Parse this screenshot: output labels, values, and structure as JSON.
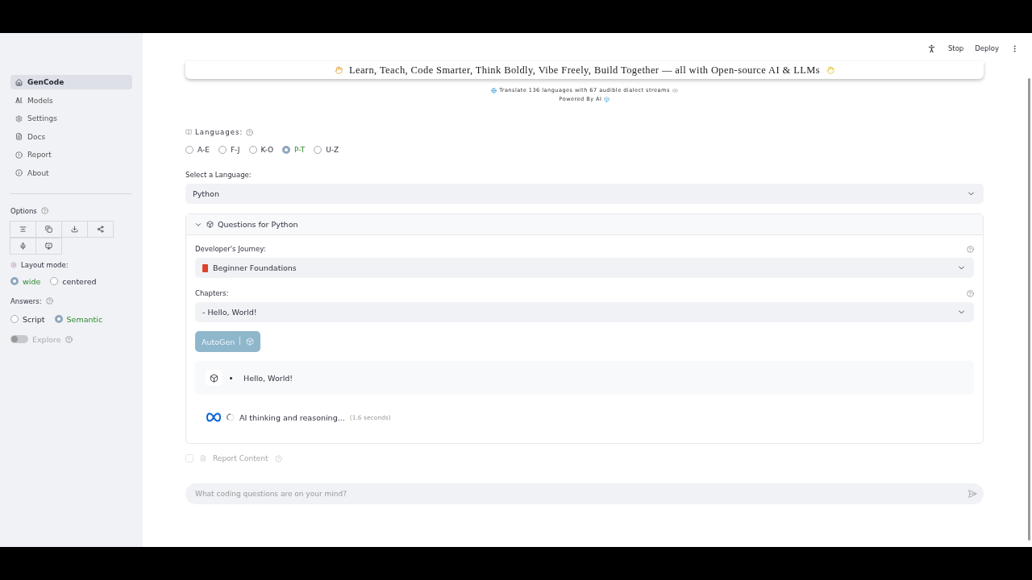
{
  "toolbar": {
    "status": "Stop",
    "deploy": "Deploy"
  },
  "sidebar": {
    "nav": [
      {
        "label": "GenCode",
        "selected": true
      },
      {
        "label": "Models",
        "selected": false
      },
      {
        "label": "Settings",
        "selected": false
      },
      {
        "label": "Docs",
        "selected": false
      },
      {
        "label": "Report",
        "selected": false
      },
      {
        "label": "About",
        "selected": false
      }
    ],
    "options_label": "Options",
    "layout_label": "Layout mode:",
    "layout_modes": [
      {
        "label": "wide",
        "selected": true
      },
      {
        "label": "centered",
        "selected": false
      }
    ],
    "answers_label": "Answers:",
    "answers": [
      {
        "label": "Script",
        "selected": false
      },
      {
        "label": "Semantic",
        "selected": true
      }
    ],
    "explore": {
      "label": "Explore",
      "on": false
    }
  },
  "banner": {
    "text": "Learn, Teach, Code Smarter, Think Boldly, Vibe Freely, Build Together — all with Open-source AI & LLMs",
    "line1": "Translate 136 languages with 67 audible dialect streams",
    "line2": "Powered By AI"
  },
  "languages": {
    "label": "Languages:",
    "ranges": [
      {
        "label": "A-E",
        "selected": false
      },
      {
        "label": "F-J",
        "selected": false
      },
      {
        "label": "K-O",
        "selected": false
      },
      {
        "label": "P-T",
        "selected": true
      },
      {
        "label": "U-Z",
        "selected": false
      }
    ]
  },
  "language_select": {
    "label": "Select a Language:",
    "value": "Python"
  },
  "questions": {
    "title": "Questions for Python",
    "expanded": true,
    "journey": {
      "label": "Developer's Journey:",
      "value": "Beginner Foundations"
    },
    "chapters": {
      "label": "Chapters:",
      "value": "- Hello, World!"
    },
    "autogen": {
      "label": "AutoGen"
    },
    "answer": "Hello, World!",
    "thinking": "AI thinking and reasoning...",
    "elapsed": "(1.6 seconds)"
  },
  "report": {
    "label": "Report Content",
    "checked": false,
    "disabled": true
  },
  "chat": {
    "placeholder": "What coding questions are on your mind?"
  }
}
